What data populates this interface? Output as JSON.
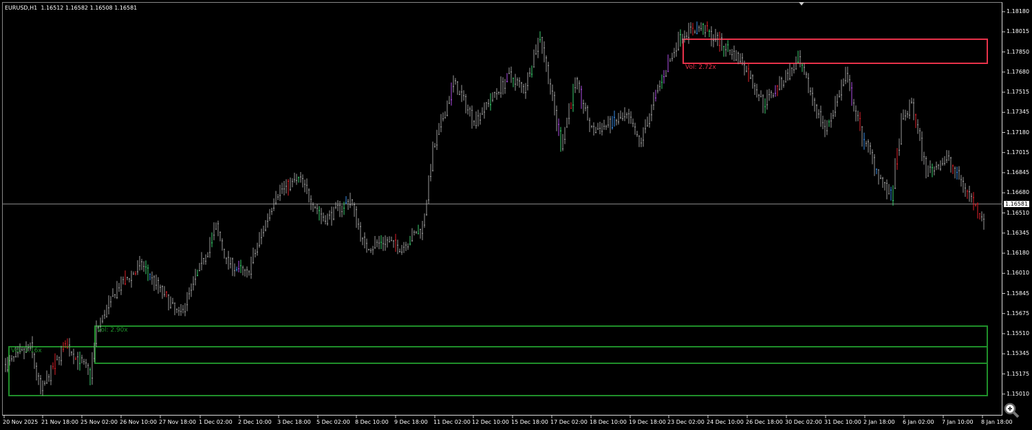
{
  "header": {
    "symbol": "EURUSD,H1",
    "ohlc": "1.16512 1.16582 1.16508 1.16581"
  },
  "current_price": "1.16581",
  "y_axis": [
    "1.18180",
    "1.18015",
    "1.17850",
    "1.17680",
    "1.17515",
    "1.17345",
    "1.17180",
    "1.17015",
    "1.16845",
    "1.16680",
    "1.16510",
    "1.16345",
    "1.16180",
    "1.16010",
    "1.15845",
    "1.15675",
    "1.15510",
    "1.15345",
    "1.15175",
    "1.15010"
  ],
  "x_axis": [
    "20 Nov 2025",
    "21 Nov 18:00",
    "25 Nov 02:00",
    "26 Nov 10:00",
    "27 Nov 18:00",
    "1 Dec 02:00",
    "2 Dec 10:00",
    "3 Dec 18:00",
    "5 Dec 02:00",
    "8 Dec 10:00",
    "9 Dec 18:00",
    "11 Dec 02:00",
    "12 Dec 10:00",
    "15 Dec 18:00",
    "17 Dec 02:00",
    "18 Dec 10:00",
    "19 Dec 18:00",
    "23 Dec 02:00",
    "24 Dec 10:00",
    "26 Dec 18:00",
    "30 Dec 02:00",
    "31 Dec 10:00",
    "2 Jan 18:00",
    "6 Jan 02:00",
    "7 Jan 10:00",
    "8 Jan 18:00"
  ],
  "zones": [
    {
      "label": "Vol: 3.16x",
      "color": "#1f8f2a"
    },
    {
      "label": "Vol: 2.90x",
      "color": "#1f8f2a"
    },
    {
      "label": "Vol: 2.72x",
      "color": "#e8324a"
    }
  ],
  "colors": {
    "candle": "#9a9a9a",
    "bull": "#3bd16f",
    "bear": "#e0202a",
    "blue": "#3a8ee8",
    "purple": "#b050e8"
  },
  "price_path": [
    [
      0,
      1.1525
    ],
    [
      12,
      1.15393
    ],
    [
      17,
      1.15022
    ],
    [
      29,
      1.15421
    ],
    [
      41,
      1.15165
    ],
    [
      44,
      1.15535
    ],
    [
      54,
      1.15877
    ],
    [
      66,
      1.16077
    ],
    [
      84,
      1.15649
    ],
    [
      94,
      1.16048
    ],
    [
      102,
      1.1639
    ],
    [
      107,
      1.16105
    ],
    [
      117,
      1.15991
    ],
    [
      131,
      1.16675
    ],
    [
      142,
      1.16789
    ],
    [
      154,
      1.16447
    ],
    [
      167,
      1.16618
    ],
    [
      174,
      1.16219
    ],
    [
      184,
      1.16276
    ],
    [
      191,
      1.16219
    ],
    [
      202,
      1.1639
    ],
    [
      207,
      1.17017
    ],
    [
      217,
      1.17587
    ],
    [
      227,
      1.17274
    ],
    [
      244,
      1.17644
    ],
    [
      251,
      1.1753
    ],
    [
      259,
      1.17986
    ],
    [
      269,
      1.17074
    ],
    [
      276,
      1.17587
    ],
    [
      284,
      1.17188
    ],
    [
      301,
      1.17302
    ],
    [
      307,
      1.17074
    ],
    [
      317,
      1.17587
    ],
    [
      327,
      1.17986
    ],
    [
      337,
      1.18043
    ],
    [
      357,
      1.17758
    ],
    [
      367,
      1.17416
    ],
    [
      384,
      1.17758
    ],
    [
      397,
      1.17188
    ],
    [
      407,
      1.17644
    ],
    [
      414,
      1.17188
    ],
    [
      424,
      1.16789
    ],
    [
      429,
      1.16618
    ],
    [
      434,
      1.17245
    ],
    [
      439,
      1.17416
    ],
    [
      446,
      1.16846
    ],
    [
      456,
      1.1696
    ],
    [
      464,
      1.16732
    ],
    [
      474,
      1.16447
    ]
  ]
}
